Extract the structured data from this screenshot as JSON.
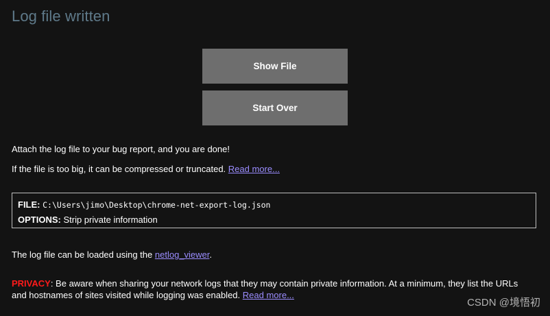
{
  "page": {
    "title": "Log file written"
  },
  "buttons": {
    "show_file": "Show File",
    "start_over": "Start Over"
  },
  "info": {
    "attach_text": "Attach the log file to your bug report, and you are done!",
    "too_big_text": "If the file is too big, it can be compressed or truncated. ",
    "read_more_label": "Read more..."
  },
  "file_box": {
    "file_key": "FILE:",
    "file_path": "C:\\Users\\jimo\\Desktop\\chrome-net-export-log.json",
    "options_key": "OPTIONS:",
    "options_value": "Strip private information"
  },
  "netlog": {
    "prefix": "The log file can be loaded using the ",
    "link_label": "netlog_viewer",
    "suffix": "."
  },
  "privacy": {
    "label": "PRIVACY",
    "text": ": Be aware when sharing your network logs that they may contain private information. At a minimum, they list the URLs and hostnames of sites visited while logging was enabled. ",
    "read_more_label": "Read more..."
  },
  "watermark": {
    "text": "CSDN @境悟初"
  },
  "colors": {
    "background": "#131313",
    "title": "#5f7a8a",
    "button": "#6e6e6e",
    "link": "#9b8dff",
    "privacy": "#ff1a1a"
  }
}
